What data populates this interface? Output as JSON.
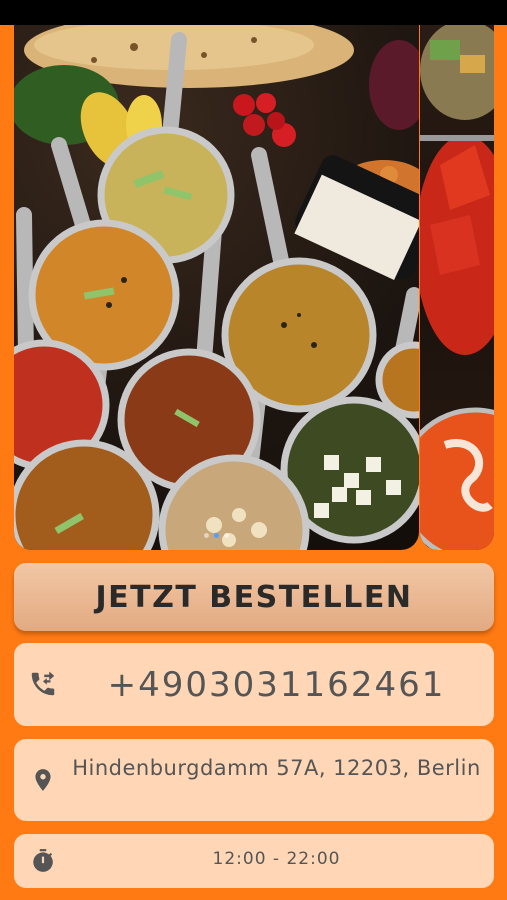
{
  "order_button": {
    "label": "JETZT BESTELLEN"
  },
  "contact": {
    "phone": "+4903031162461",
    "address": "Hindenburgdamm 57A, 12203, Berlin",
    "hours": "12:00 - 22:00"
  },
  "carousel": {
    "slide_count": 3,
    "active_index": 1
  },
  "icons": {
    "phone": "phone-forward-icon",
    "location": "location-pin-icon",
    "hours": "stopwatch-icon"
  },
  "colors": {
    "background": "#ff7a12",
    "button": "#e8b38d",
    "card": "#ffd7b6",
    "text": "#555555",
    "active_dot": "#4aa3ff"
  }
}
